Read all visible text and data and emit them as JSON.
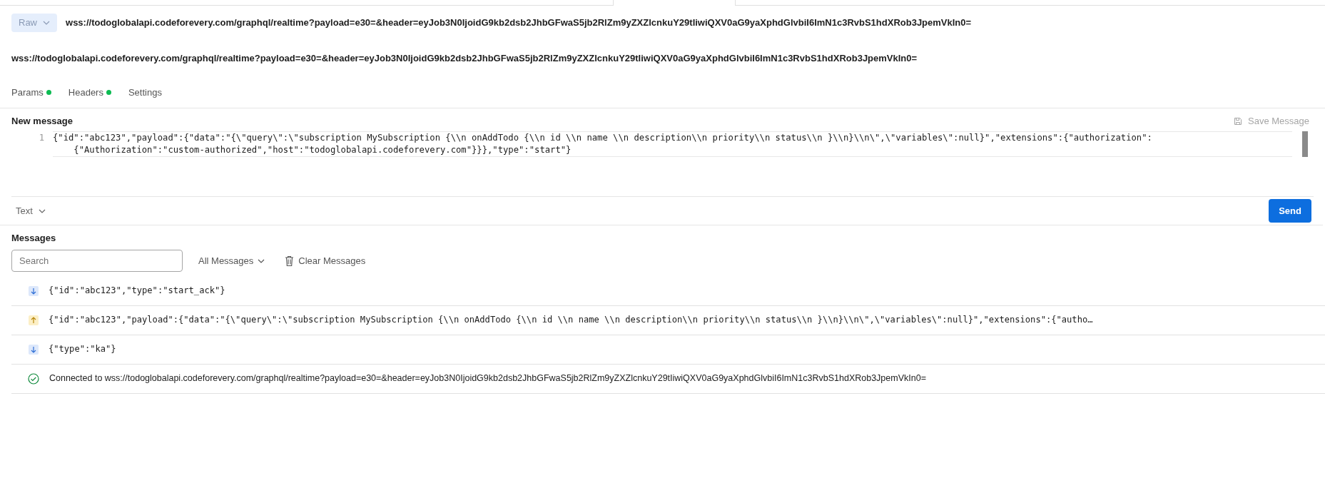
{
  "request": {
    "mode": "Raw",
    "url": "wss://todoglobalapi.codeforevery.com/graphql/realtime?payload=e30=&header=eyJob3N0IjoidG9kb2dsb2JhbGFwaS5jb2RlZm9yZXZlcnkuY29tIiwiQXV0aG9yaXphdGlvbiI6ImN1c3RvbS1hdXRob3JpemVkIn0="
  },
  "connection_url": "wss://todoglobalapi.codeforevery.com/graphql/realtime?payload=e30=&header=eyJob3N0IjoidG9kb2dsb2JhbGFwaS5jb2RlZm9yZXZlcnkuY29tIiwiQXV0aG9yaXphdGlvbiI6ImN1c3RvbS1hdXRob3JpemVkIn0=",
  "tabs": [
    {
      "label": "Params",
      "indicator": true
    },
    {
      "label": "Headers",
      "indicator": true
    },
    {
      "label": "Settings",
      "indicator": false
    }
  ],
  "composer": {
    "title": "New message",
    "save_label": "Save Message",
    "lines": [
      {
        "number": "1",
        "parts": [
          "{\"id\":\"abc123\",\"payload\":{\"data\":\"{\\\"query\\\":\\\"subscription MySubscription {\\\\n onAddTodo {\\\\n id \\\\n name \\\\n description\\\\n priority\\\\n status\\\\n }\\\\n}\\\\n\\\",\\\"variables\\\":null}\",\"extensions\":{\"authorization\":",
          "{\"Authorization\":\"custom-authorized\",\"host\":\"todoglobalapi.codeforevery.com\"}}},\"type\":\"start\"}"
        ]
      }
    ],
    "format": "Text",
    "send_label": "Send"
  },
  "messages": {
    "title": "Messages",
    "search_placeholder": "Search",
    "filter": "All Messages",
    "clear_label": "Clear Messages",
    "items": [
      {
        "kind": "received",
        "text": "{\"id\":\"abc123\",\"type\":\"start_ack\"}"
      },
      {
        "kind": "sent",
        "text": "{\"id\":\"abc123\",\"payload\":{\"data\":\"{\\\"query\\\":\\\"subscription MySubscription {\\\\n onAddTodo {\\\\n id \\\\n name \\\\n description\\\\n priority\\\\n status\\\\n }\\\\n}\\\\n\\\",\\\"variables\\\":null}\",\"extensions\":{\"autho…"
      },
      {
        "kind": "received",
        "text": "{\"type\":\"ka\"}"
      },
      {
        "kind": "connected",
        "text": "Connected to wss://todoglobalapi.codeforevery.com/graphql/realtime?payload=e30=&header=eyJob3N0IjoidG9kb2dsb2JhbGFwaS5jb2RlZm9yZXZlcnkuY29tIiwiQXV0aG9yaXphdGlvbiI6ImN1c3RvbS1hdXRob3JpemVkIn0="
      }
    ]
  }
}
